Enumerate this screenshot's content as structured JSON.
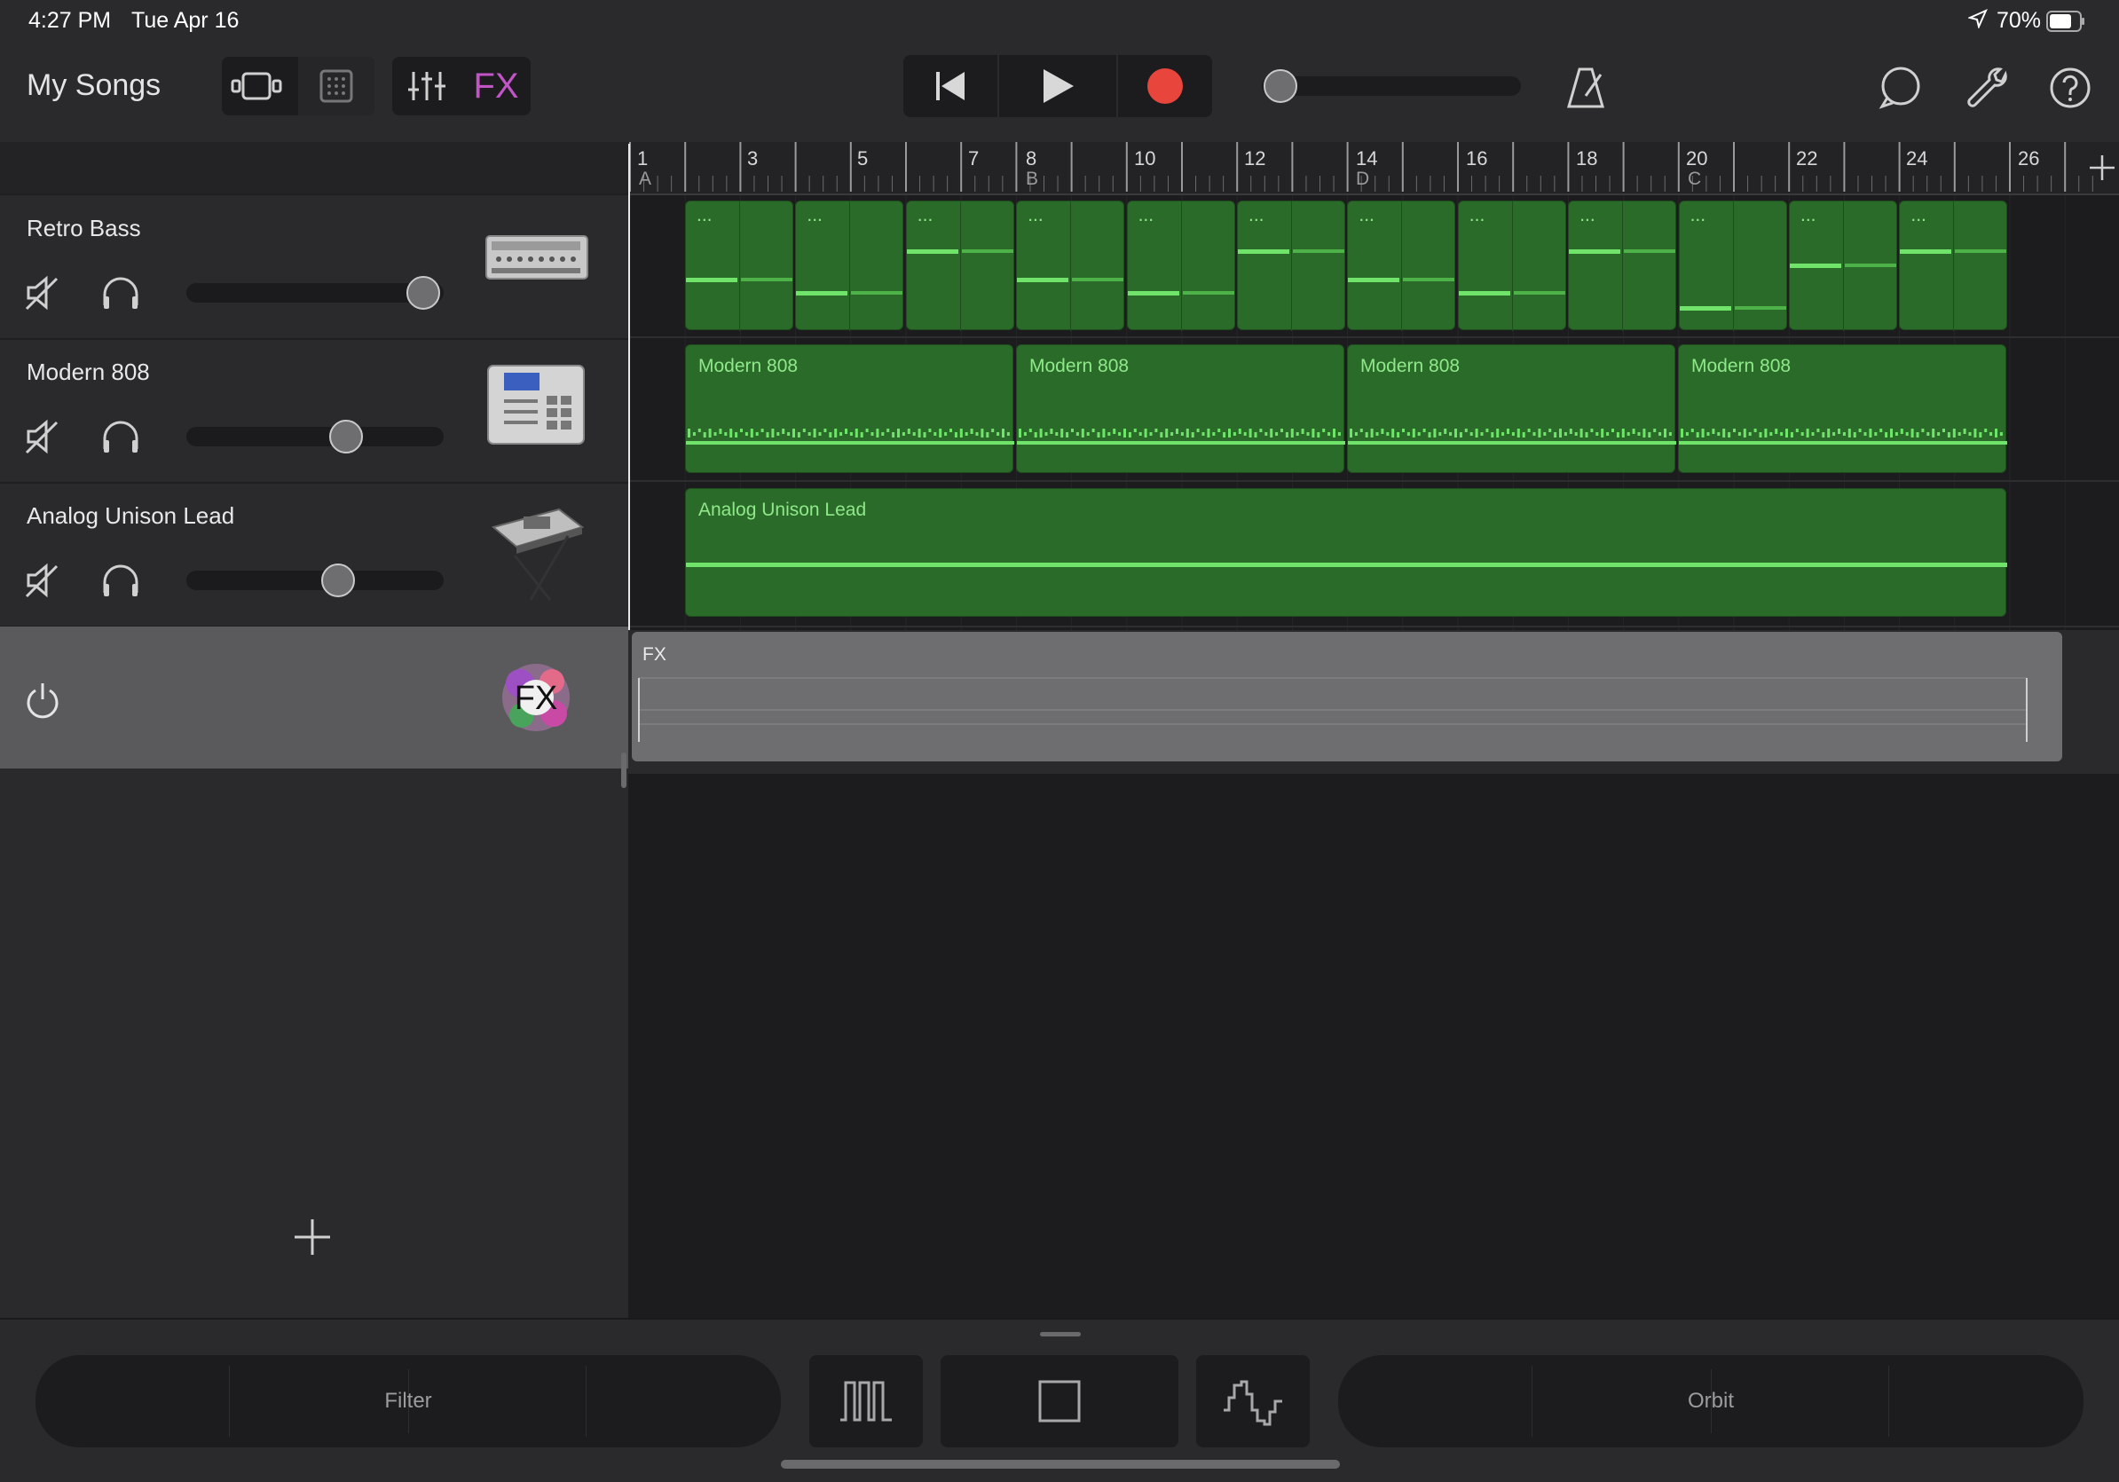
{
  "status_bar": {
    "time": "4:27 PM",
    "date": "Tue Apr 16",
    "battery": "70%"
  },
  "toolbar": {
    "my_songs": "My Songs",
    "fx_label": "FX"
  },
  "ruler": {
    "bars": [
      "1",
      "3",
      "5",
      "7",
      "8",
      "10",
      "12",
      "14",
      "16",
      "18",
      "20",
      "22",
      "24",
      "26"
    ],
    "sections": [
      "A",
      "B",
      "D",
      "C"
    ]
  },
  "tracks": [
    {
      "name": "Retro Bass",
      "volume": 0.92
    },
    {
      "name": "Modern 808",
      "volume": 0.62
    },
    {
      "name": "Analog Unison Lead",
      "volume": 0.59
    }
  ],
  "fx_track": {
    "label": "FX",
    "icon_text": "FX"
  },
  "regions": {
    "retro_bass_label": "...",
    "modern808_label": "Modern 808",
    "lead_label": "Analog Unison Lead",
    "fx_label": "FX"
  },
  "bottom_bar": {
    "left_label": "Filter",
    "right_label": "Orbit"
  },
  "colors": {
    "accent_fx": "#c254c8",
    "record": "#e8453c",
    "region_green": "#2b6b29",
    "note_green": "#6fe36a"
  }
}
